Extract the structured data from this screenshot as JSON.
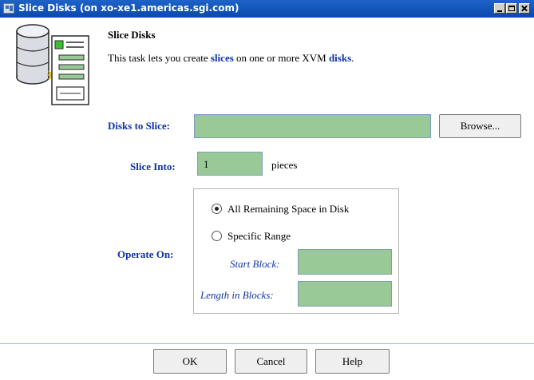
{
  "window": {
    "title": "Slice Disks (on xo-xe1.americas.sgi.com)"
  },
  "header": {
    "heading": "Slice Disks",
    "desc_before": "This task lets you create ",
    "desc_kw1": "slices",
    "desc_middle": " on one or more XVM ",
    "desc_kw2": "disks",
    "desc_after": "."
  },
  "form": {
    "disks_label": "Disks to Slice:",
    "disks_value": "",
    "browse_label": "Browse...",
    "slice_into_label": "Slice Into:",
    "slice_into_value": "1",
    "pieces_label": "pieces",
    "operate_on_label": "Operate On:",
    "option_all": "All Remaining Space in Disk",
    "option_range": "Specific Range",
    "selected_option": "All Remaining Space in Disk",
    "start_block_label": "Start Block:",
    "start_block_value": "",
    "length_label": "Length in Blocks:",
    "length_value": ""
  },
  "buttons": {
    "ok": "OK",
    "cancel": "Cancel",
    "help": "Help"
  },
  "colors": {
    "titlebar": "#0b48ac",
    "label_blue": "#1033a6",
    "field_green": "#98c996"
  }
}
